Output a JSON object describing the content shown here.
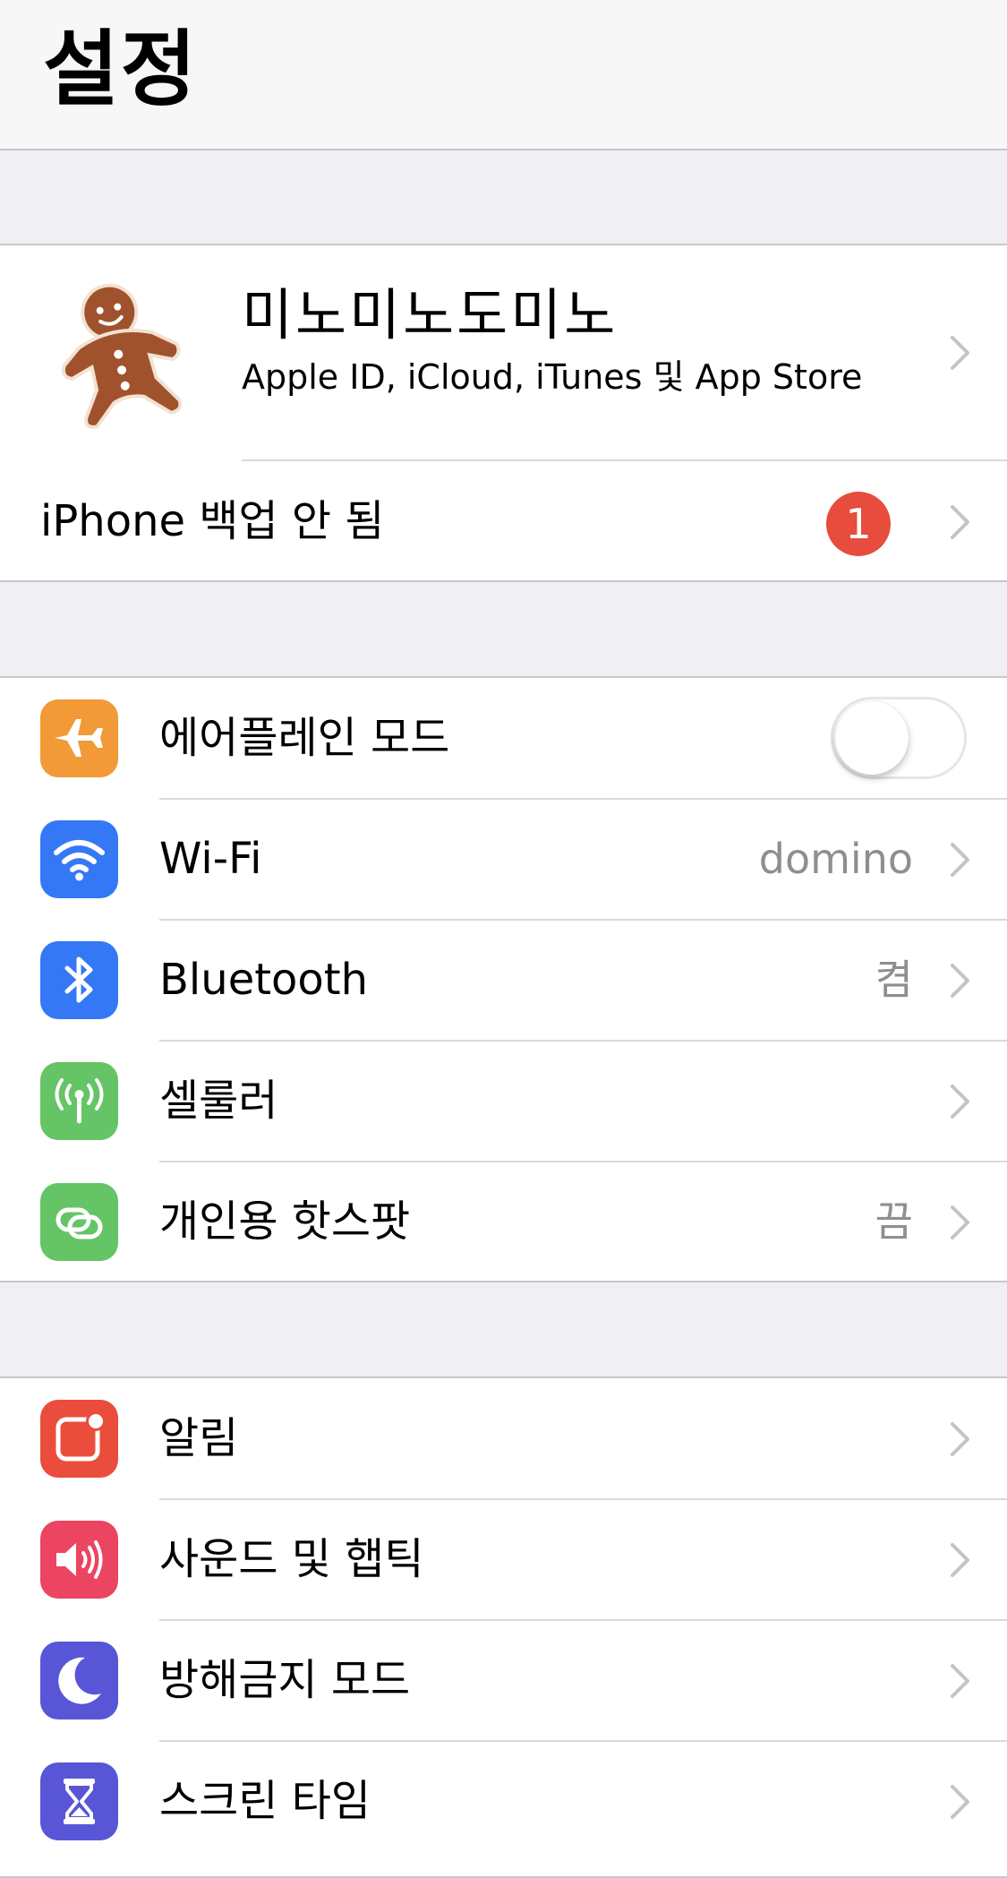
{
  "header": {
    "title": "설정"
  },
  "profile": {
    "name": "미노미노도미노",
    "subtitle": "Apple ID, iCloud, iTunes 및 App Store"
  },
  "backup": {
    "label": "iPhone 백업 안 됨",
    "badge": "1"
  },
  "connectivity": [
    {
      "label": "에어플레인 모드",
      "icon": "airplane-icon",
      "color": "#f19a37",
      "toggle": false
    },
    {
      "label": "Wi-Fi",
      "value": "domino",
      "icon": "wifi-icon",
      "color": "#3478f6"
    },
    {
      "label": "Bluetooth",
      "value": "켬",
      "icon": "bluetooth-icon",
      "color": "#3478f6"
    },
    {
      "label": "셀룰러",
      "icon": "cellular-antenna-icon",
      "color": "#65c466"
    },
    {
      "label": "개인용 핫스팟",
      "value": "끔",
      "icon": "hotspot-link-icon",
      "color": "#65c466"
    }
  ],
  "notifications_group": [
    {
      "label": "알림",
      "icon": "notifications-icon",
      "color": "#eb4d3d"
    },
    {
      "label": "사운드 및 햅틱",
      "icon": "speaker-icon",
      "color": "#eb4561"
    },
    {
      "label": "방해금지 모드",
      "icon": "moon-icon",
      "color": "#5856d6"
    },
    {
      "label": "스크린 타임",
      "icon": "hourglass-icon",
      "color": "#5856d6"
    }
  ]
}
